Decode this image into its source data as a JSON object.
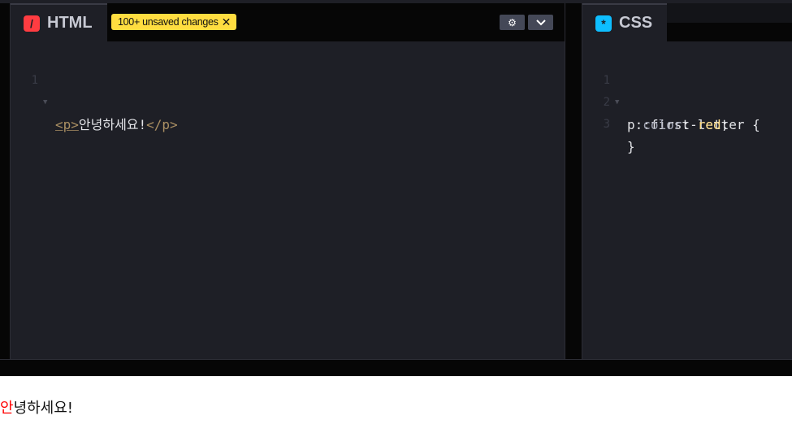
{
  "html_pane": {
    "tab_title": "HTML",
    "icon_glyph": "/",
    "icon_color": "#ff3c41",
    "unsaved_badge": "100+ unsaved changes",
    "unsaved_close": "✕",
    "settings_glyph": "⚙",
    "collapse_glyph": "⌄",
    "lines": [
      {
        "number": "1",
        "open_tag": "<p>",
        "text": "안녕하세요!",
        "close_tag": "</p>"
      }
    ]
  },
  "css_pane": {
    "tab_title": "CSS",
    "icon_glyph": "*",
    "icon_color": "#0ebeff",
    "lines": [
      {
        "number": "1",
        "selector": "p::first-letter",
        "brace": " {"
      },
      {
        "number": "2",
        "property": "color",
        "colon": ": ",
        "value": "red",
        "semi": ";"
      },
      {
        "number": "3",
        "brace": "}"
      }
    ]
  },
  "preview": {
    "first_letter": "안",
    "rest": "녕하세요!",
    "first_letter_color": "#ff0000"
  }
}
